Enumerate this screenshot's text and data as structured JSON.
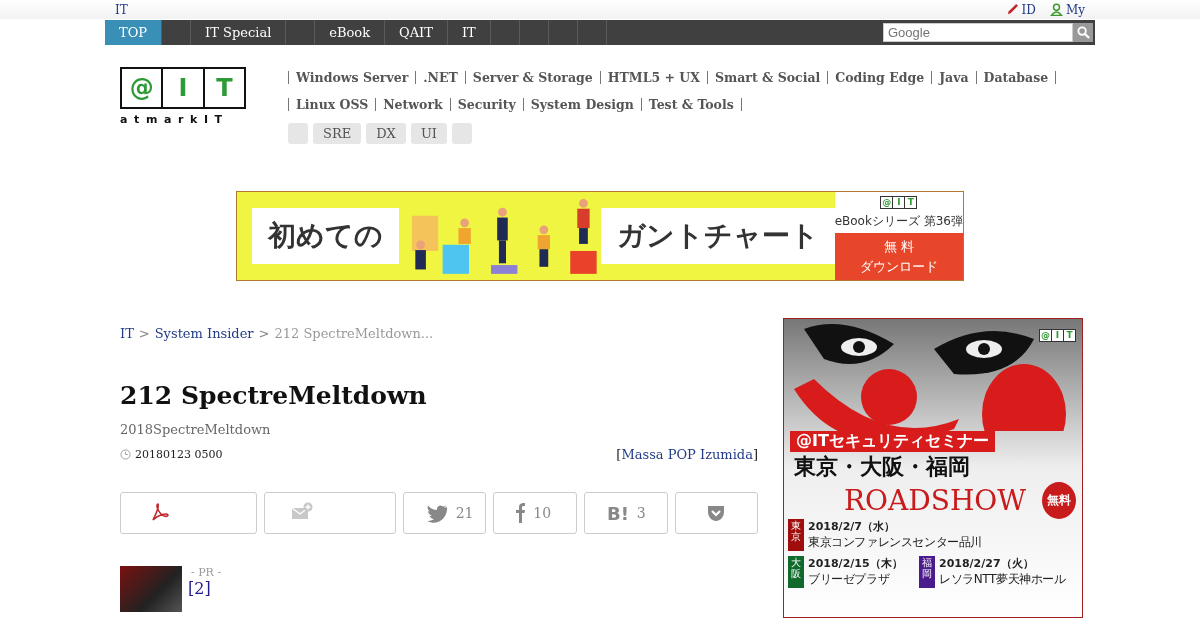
{
  "top_bar": {
    "site_link": "IT",
    "links": [
      {
        "kind": "pen",
        "label": "ID"
      },
      {
        "kind": "person",
        "label": "My"
      }
    ]
  },
  "nav": {
    "tabs": [
      {
        "label": "TOP",
        "selected": true
      },
      {
        "selected": false
      },
      {
        "label": "IT Special",
        "selected": false
      },
      {
        "selected": false
      },
      {
        "label": "eBook",
        "selected": false
      },
      {
        "label": "QAIT",
        "selected": false
      },
      {
        "label": "IT",
        "selected": false
      },
      {
        "selected": false
      },
      {
        "selected": false
      },
      {
        "selected": false
      },
      {
        "selected": false
      }
    ],
    "search": {
      "placeholder": "Google"
    }
  },
  "logo": {
    "letters": [
      "@",
      "I",
      "T"
    ],
    "caption": "atmarkIT"
  },
  "categories": [
    [
      "Windows Server",
      ".NET",
      "Server & Storage",
      "HTML5 + UX",
      "Smart & Social",
      "Coding Edge",
      "Java",
      "Database"
    ],
    [
      "Linux  OSS",
      "Network",
      "Security",
      "System Design",
      "Test & Tools"
    ]
  ],
  "tags": [
    {
      "kind": "blank"
    },
    {
      "kind": "label",
      "label": "SRE"
    },
    {
      "kind": "label",
      "label": "DX"
    },
    {
      "kind": "label",
      "label": "UI"
    },
    {
      "kind": "blank"
    }
  ],
  "top_banner": {
    "logo_letters": [
      "@",
      "I",
      "T"
    ],
    "left": "初めての",
    "right": "ガントチャート",
    "series": "eBookシリーズ 第36弾",
    "cta": [
      "無 料",
      "ダウンロード"
    ]
  },
  "breadcrumb": [
    {
      "label": "IT",
      "kind": "link"
    },
    {
      "label": ">",
      "kind": "sep"
    },
    {
      "label": "System Insider",
      "kind": "link"
    },
    {
      "label": ">",
      "kind": "sep"
    },
    {
      "label": "212 SpectreMeltdown...",
      "kind": "current"
    }
  ],
  "article": {
    "title": "212 SpectreMeltdown",
    "subtitle": "2018SpectreMeltdown",
    "date": "20180123 0500",
    "author_open": "[",
    "author": "Massa POP Izumida",
    "author_close": "]"
  },
  "share_buttons": [
    {
      "kind": "pdf"
    },
    {
      "kind": "mail"
    },
    {
      "kind": "twitter",
      "count": "21"
    },
    {
      "kind": "facebook",
      "count": "10"
    },
    {
      "kind": "hatena",
      "mark": "B!",
      "count": "3"
    },
    {
      "kind": "pocket"
    }
  ],
  "pr": {
    "label": "- PR -",
    "link": "[2]"
  },
  "side_ad": {
    "logo_letters": [
      "@",
      "I",
      "T"
    ],
    "headline": "@ITセキュリティセミナー",
    "cities": "東京・大阪・福岡",
    "roadshow": "ROADSHOW",
    "badge": "無料",
    "events": [
      {
        "city": "東京",
        "date": "2018/2/7（水）",
        "venue": "東京コンファレンスセンター品川",
        "color": "#a00d0d"
      },
      {
        "city": "大阪",
        "date": "2018/2/15（木）",
        "venue": "ブリーゼプラザ",
        "color": "#0f6a2c"
      },
      {
        "city": "福岡",
        "date": "2018/2/27（火）",
        "venue": "レソラNTT夢天神ホール",
        "color": "#4b1a8c"
      }
    ]
  }
}
